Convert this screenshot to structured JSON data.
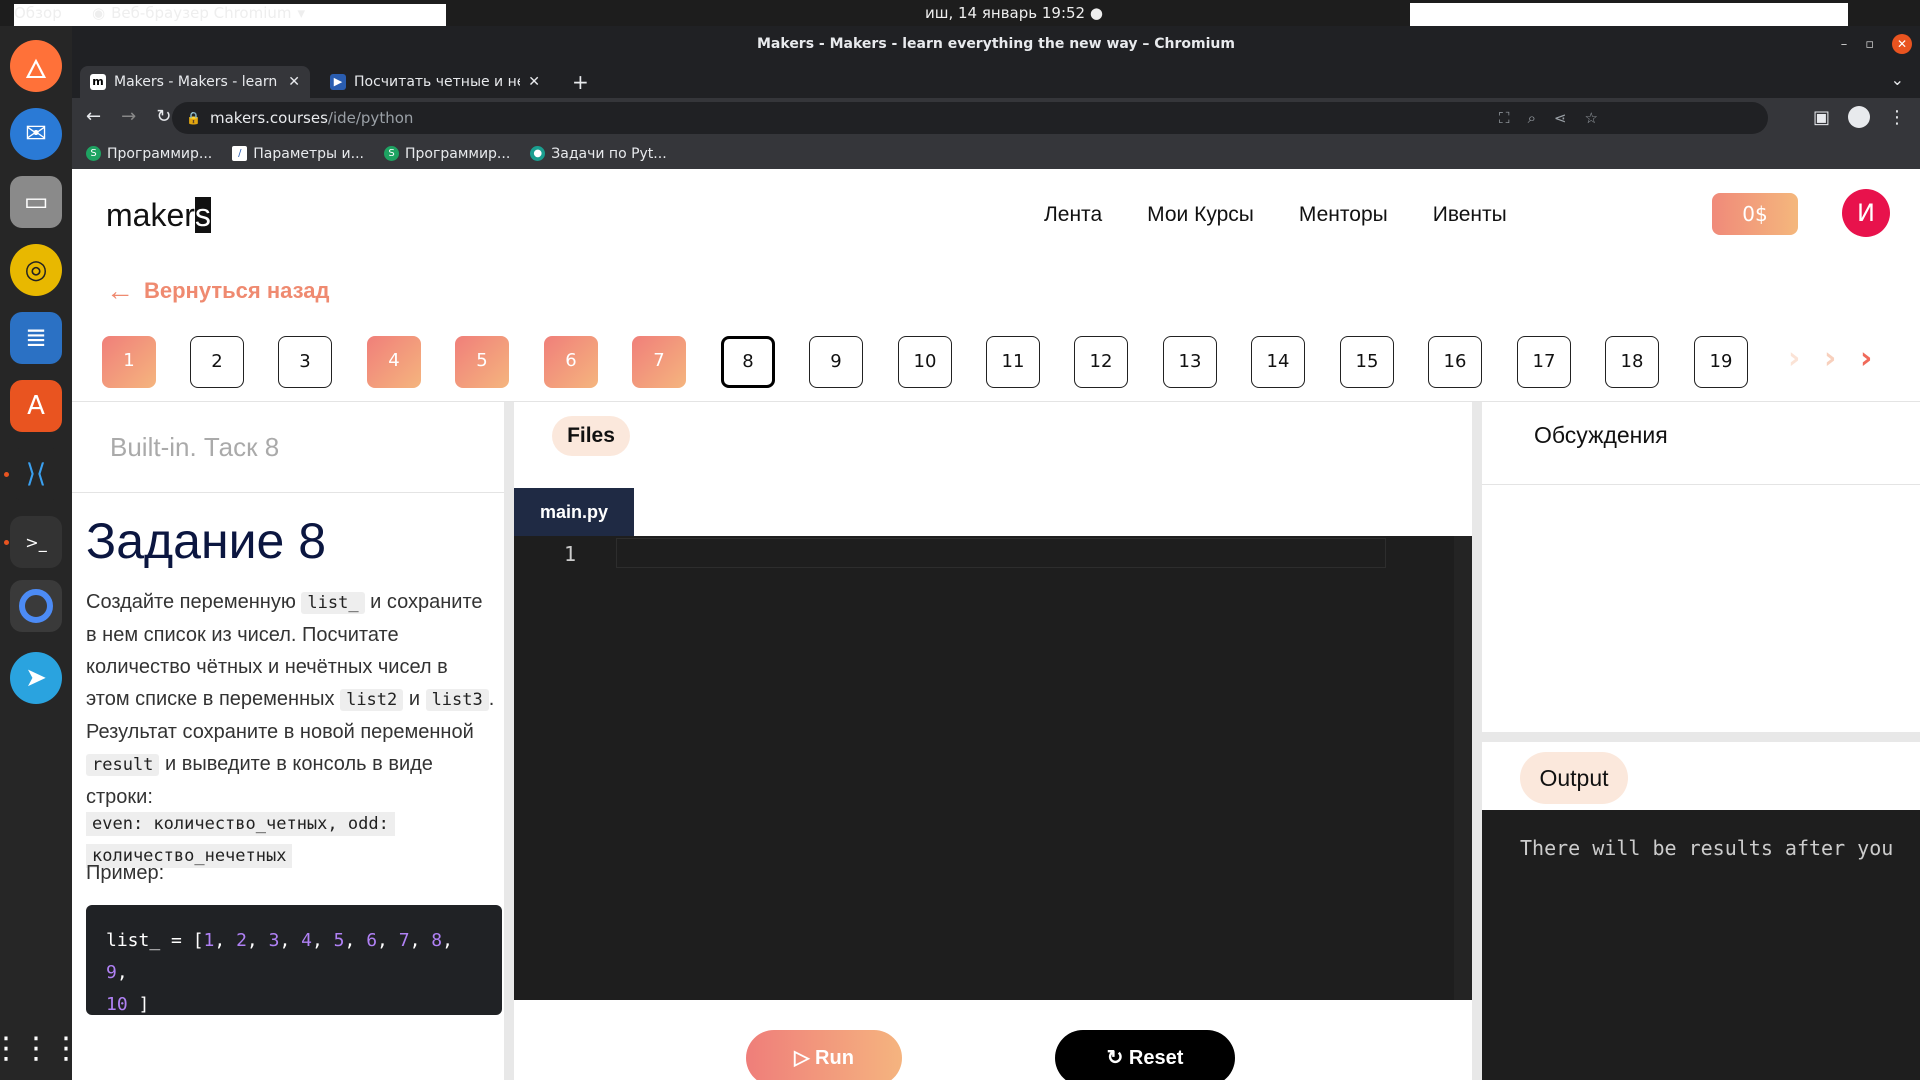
{
  "os": {
    "overview": "Обзор",
    "app_name": "Веб-браузер Chromium",
    "clock": "иш, 14 январь  19:52",
    "lang": "en"
  },
  "window": {
    "title": "Makers - Makers - learn everything the new way – Chromium"
  },
  "tabs": [
    {
      "label": "Makers - Makers - learn everything the new way",
      "favicon": "m"
    },
    {
      "label": "Посчитать четные и нечетные",
      "favicon": "▶"
    }
  ],
  "address": {
    "host": "makers.courses",
    "path": "/ide/python"
  },
  "bookmarks": [
    {
      "label": "Программир...",
      "icon": "S"
    },
    {
      "label": "Параметры и...",
      "icon": "/"
    },
    {
      "label": "Программир...",
      "icon": "S"
    },
    {
      "label": "Задачи по Pyt...",
      "icon": "●"
    }
  ],
  "site": {
    "logo_main": "maker",
    "logo_last": "s",
    "nav": [
      "Лента",
      "Мои Курсы",
      "Менторы",
      "Ивенты"
    ],
    "balance": "0$",
    "avatar_letter": "И",
    "back_label": "Вернуться назад"
  },
  "steps": {
    "items": [
      "1",
      "2",
      "3",
      "4",
      "5",
      "6",
      "7",
      "8",
      "9",
      "10",
      "11",
      "12",
      "13",
      "14",
      "15",
      "16",
      "17",
      "18",
      "19"
    ],
    "done": [
      1,
      4,
      5,
      6,
      7
    ],
    "current": 8
  },
  "task": {
    "subtitle": "Built-in. Таск 8",
    "title": "Задание 8",
    "desc_1": "Создайте переменную",
    "code_list": "list_",
    "desc_2": "и сохраните в нем список из чисел. Посчитате количество чётных и нечётных чисел в этом списке в переменных",
    "code_list2": "list2",
    "desc_and": "и",
    "code_list3": "list3",
    "desc_3": ". Результат сохраните в новой переменной",
    "code_result": "result",
    "desc_4": "и выведите в консоль в виде строки:",
    "format_line1": "even: количество_четных, odd:",
    "format_line2": "количество_нечетных",
    "example_label": "Пример:",
    "example_prefix": "list_ = [",
    "example_numbers": [
      "1",
      "2",
      "3",
      "4",
      "5",
      "6",
      "7",
      "8",
      "9",
      "10"
    ],
    "example_suffix": " ]"
  },
  "ide": {
    "files_label": "Files",
    "file_tab": "main.py",
    "line_number": "1",
    "run_label": "Run",
    "reset_label": "Reset"
  },
  "right_panel": {
    "discussions": "Обсуждения",
    "output_label": "Output",
    "output_text": "There will be results after you"
  }
}
